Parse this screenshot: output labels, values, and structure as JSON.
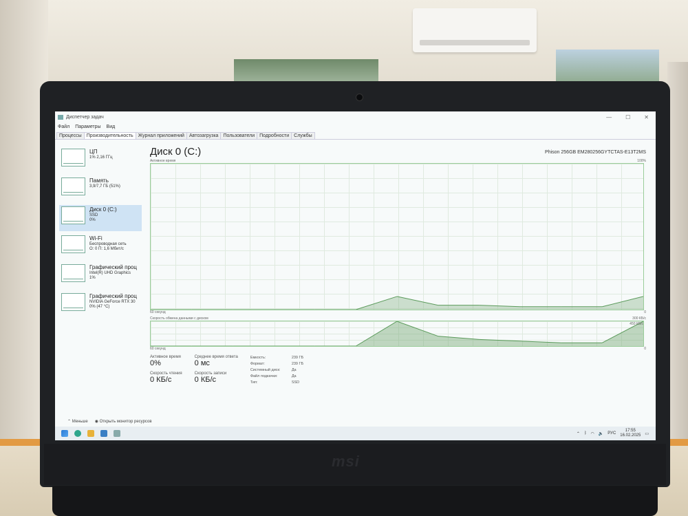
{
  "window": {
    "title": "Диспетчер задач"
  },
  "menu": [
    "Файл",
    "Параметры",
    "Вид"
  ],
  "tabs": [
    "Процессы",
    "Производительность",
    "Журнал приложений",
    "Автозагрузка",
    "Пользователи",
    "Подробности",
    "Службы"
  ],
  "sidebar": [
    {
      "title": "ЦП",
      "line1": "1% 2,16 ГГц",
      "line2": ""
    },
    {
      "title": "Память",
      "line1": "3,9/7,7 ГБ (51%)",
      "line2": ""
    },
    {
      "title": "Диск 0 (C:)",
      "line1": "SSD",
      "line2": "0%"
    },
    {
      "title": "Wi-Fi",
      "line1": "Беспроводная сеть",
      "line2": "О: 0 П: 1,6 Мбит/с"
    },
    {
      "title": "Графический проц",
      "line1": "Intel(R) UHD Graphics",
      "line2": "1%"
    },
    {
      "title": "Графический проц",
      "line1": "NVIDIA GeForce RTX 30",
      "line2": "0% (47 °C)"
    }
  ],
  "main": {
    "title": "Диск 0 (C:)",
    "model": "Phison 256GB EM280256GYTCTAS-E13T2MS",
    "chart1": {
      "label": "Активное время",
      "max": "100%",
      "left": "60 секунд",
      "right": "0"
    },
    "chart2": {
      "label": "Скорость обмена данными с диском",
      "max": "300 КБ/с",
      "inner": "450 КБ/с",
      "left": "60 секунд",
      "right": "0"
    },
    "stats": {
      "active_label": "Активное время",
      "active_value": "0%",
      "resp_label": "Среднее время ответа",
      "resp_value": "0 мс",
      "read_label": "Скорость чтения",
      "read_value": "0 КБ/с",
      "write_label": "Скорость записи",
      "write_value": "0 КБ/с"
    },
    "props": [
      {
        "k": "Емкость:",
        "v": "239 ГБ"
      },
      {
        "k": "Формат:",
        "v": "239 ГБ"
      },
      {
        "k": "Системный диск:",
        "v": "Да"
      },
      {
        "k": "Файл подкачки:",
        "v": "Да"
      },
      {
        "k": "Тип:",
        "v": "SSD"
      }
    ]
  },
  "footer": {
    "less": "Меньше",
    "monitor": "Открыть монитор ресурсов"
  },
  "taskbar": {
    "lang": "РУС",
    "time": "17:55",
    "date": "16.02.2025"
  },
  "chart_data": [
    {
      "type": "area",
      "title": "Активное время",
      "ylim": [
        0,
        100
      ],
      "x": [
        0,
        5,
        10,
        15,
        20,
        25,
        30,
        35,
        40,
        45,
        50,
        55,
        60
      ],
      "values": [
        0,
        0,
        0,
        0,
        0,
        0,
        9,
        3,
        3,
        2,
        2,
        2,
        9
      ]
    },
    {
      "type": "area",
      "title": "Скорость обмена данными с диском",
      "x": [
        0,
        5,
        10,
        15,
        20,
        25,
        30,
        35,
        40,
        45,
        50,
        55,
        60
      ],
      "values": [
        0,
        0,
        0,
        0,
        0,
        0,
        300,
        120,
        80,
        60,
        40,
        40,
        300
      ]
    }
  ]
}
